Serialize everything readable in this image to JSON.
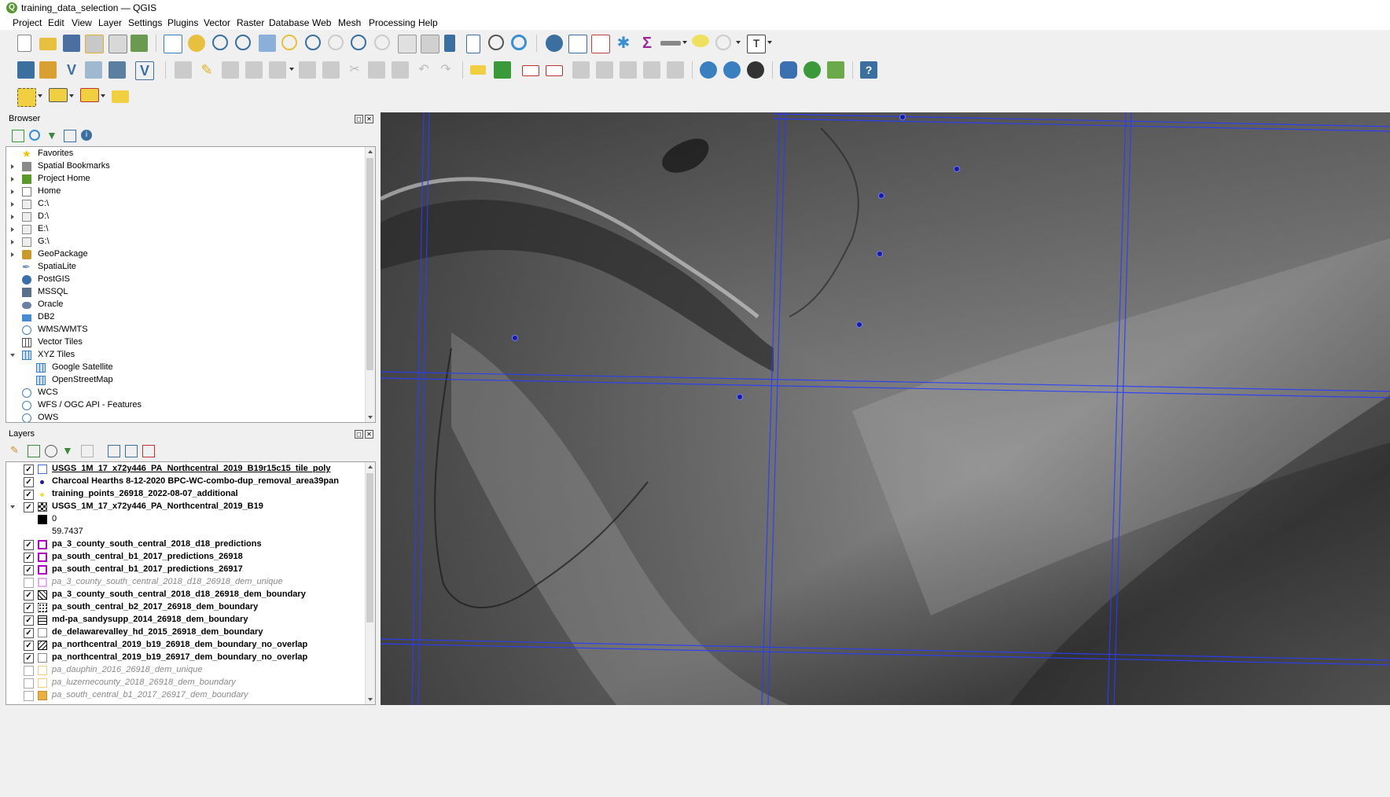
{
  "window": {
    "title": "training_data_selection — QGIS"
  },
  "menu": [
    "Project",
    "Edit",
    "View",
    "Layer",
    "Settings",
    "Plugins",
    "Vector",
    "Raster",
    "Database",
    "Web",
    "Mesh",
    "Processing",
    "Help"
  ],
  "browser": {
    "title": "Browser",
    "items": [
      {
        "label": "Favorites",
        "icon": "star-icon",
        "color": "#f2c200"
      },
      {
        "label": "Spatial Bookmarks",
        "icon": "bookmark-icon",
        "color": "#8a8a8a"
      },
      {
        "label": "Project Home",
        "icon": "project-home-icon",
        "color": "#5a9a2b"
      },
      {
        "label": "Home",
        "icon": "home-icon",
        "color": "#7a7a7a"
      },
      {
        "label": "C:\\",
        "icon": "folder-icon",
        "color": "#d9d9d9"
      },
      {
        "label": "D:\\",
        "icon": "folder-icon",
        "color": "#d9d9d9"
      },
      {
        "label": "E:\\",
        "icon": "folder-icon",
        "color": "#d9d9d9"
      },
      {
        "label": "G:\\",
        "icon": "folder-icon",
        "color": "#d9d9d9"
      },
      {
        "label": "GeoPackage",
        "icon": "geopackage-icon",
        "color": "#c79a2b"
      },
      {
        "label": "SpatiaLite",
        "icon": "spatialite-icon",
        "color": "#6c8fb3"
      },
      {
        "label": "PostGIS",
        "icon": "postgis-icon",
        "color": "#3a6fa8"
      },
      {
        "label": "MSSQL",
        "icon": "mssql-icon",
        "color": "#5a6f8c"
      },
      {
        "label": "Oracle",
        "icon": "oracle-icon",
        "color": "#6b7fa3"
      },
      {
        "label": "DB2",
        "icon": "db2-icon",
        "color": "#4a8ad4"
      },
      {
        "label": "WMS/WMTS",
        "icon": "globe-icon",
        "color": "#4a7fb0"
      },
      {
        "label": "Vector Tiles",
        "icon": "grid-icon",
        "color": "#555555"
      },
      {
        "label": "XYZ Tiles",
        "icon": "grid-icon",
        "color": "#3a7fc0"
      },
      {
        "label": "Google Satellite",
        "icon": "grid-icon",
        "color": "#3a7fc0"
      },
      {
        "label": "OpenStreetMap",
        "icon": "grid-icon",
        "color": "#3a7fc0"
      },
      {
        "label": "WCS",
        "icon": "globe-icon",
        "color": "#4a7fb0"
      },
      {
        "label": "WFS / OGC API - Features",
        "icon": "globe-icon",
        "color": "#4a7fb0"
      },
      {
        "label": "OWS",
        "icon": "globe-icon",
        "color": "#4a7fb0"
      }
    ]
  },
  "layers": {
    "title": "Layers",
    "items": [
      {
        "label": "USGS_1M_17_x72y446_PA_Northcentral_2019_B19r15c15_tile_poly",
        "checked": true,
        "style": "bold-underline",
        "symbol": "outline",
        "color": "#4a6fd1"
      },
      {
        "label": "Charcoal Hearths 8-12-2020 BPC-WC-combo-dup_removal_area39pan",
        "checked": true,
        "style": "bold",
        "symbol": "dot",
        "color": "#1a1aa0"
      },
      {
        "label": "training_points_26918_2022-08-07_additional",
        "checked": true,
        "style": "bold",
        "symbol": "dot",
        "color": "#f0e040"
      },
      {
        "label": "USGS_1M_17_x72y446_PA_Northcentral_2019_B19",
        "checked": true,
        "style": "bold",
        "symbol": "raster",
        "color": "#000000"
      },
      {
        "label": "0",
        "checked": null,
        "style": "legend",
        "symbol": "fill",
        "color": "#000000"
      },
      {
        "label": "59.7437",
        "checked": null,
        "style": "legend",
        "symbol": "none",
        "color": "#ffffff"
      },
      {
        "label": "pa_3_county_south_central_2018_d18_predictions",
        "checked": true,
        "style": "bold",
        "symbol": "outline",
        "color": "#b000c0"
      },
      {
        "label": "pa_south_central_b1_2017_predictions_26918",
        "checked": true,
        "style": "bold",
        "symbol": "outline",
        "color": "#b000c0"
      },
      {
        "label": "pa_south_central_b1_2017_predictions_26917",
        "checked": true,
        "style": "bold",
        "symbol": "outline",
        "color": "#b000c0"
      },
      {
        "label": "pa_3_county_south_central_2018_d18_26918_dem_unique",
        "checked": false,
        "style": "grey",
        "symbol": "outline",
        "color": "#e3b0ef"
      },
      {
        "label": "pa_3_county_south_central_2018_d18_26918_dem_boundary",
        "checked": true,
        "style": "bold",
        "symbol": "diag",
        "color": "#000000"
      },
      {
        "label": "pa_south_central_b2_2017_26918_dem_boundary",
        "checked": true,
        "style": "bold",
        "symbol": "dots",
        "color": "#000000"
      },
      {
        "label": "md-pa_sandysupp_2014_26918_dem_boundary",
        "checked": true,
        "style": "bold",
        "symbol": "hlines",
        "color": "#000000"
      },
      {
        "label": "de_delawarevalley_hd_2015_26918_dem_boundary",
        "checked": true,
        "style": "bold",
        "symbol": "outline",
        "color": "#8a8a8a"
      },
      {
        "label": "pa_northcentral_2019_b19_26918_dem_boundary_no_overlap",
        "checked": true,
        "style": "bold",
        "symbol": "diag2",
        "color": "#000000"
      },
      {
        "label": "pa_northcentral_2019_b19_26917_dem_boundary_no_overlap",
        "checked": true,
        "style": "bold",
        "symbol": "outline",
        "color": "#8a8a8a"
      },
      {
        "label": "pa_dauphin_2016_26918_dem_unique",
        "checked": false,
        "style": "grey",
        "symbol": "outline",
        "color": "#f0d080"
      },
      {
        "label": "pa_luzernecounty_2018_26918_dem_boundary",
        "checked": false,
        "style": "grey",
        "symbol": "outline",
        "color": "#f0d080"
      },
      {
        "label": "pa_south_central_b1_2017_26917_dem_boundary",
        "checked": false,
        "style": "grey",
        "symbol": "fill",
        "color": "#e8b040"
      }
    ]
  }
}
